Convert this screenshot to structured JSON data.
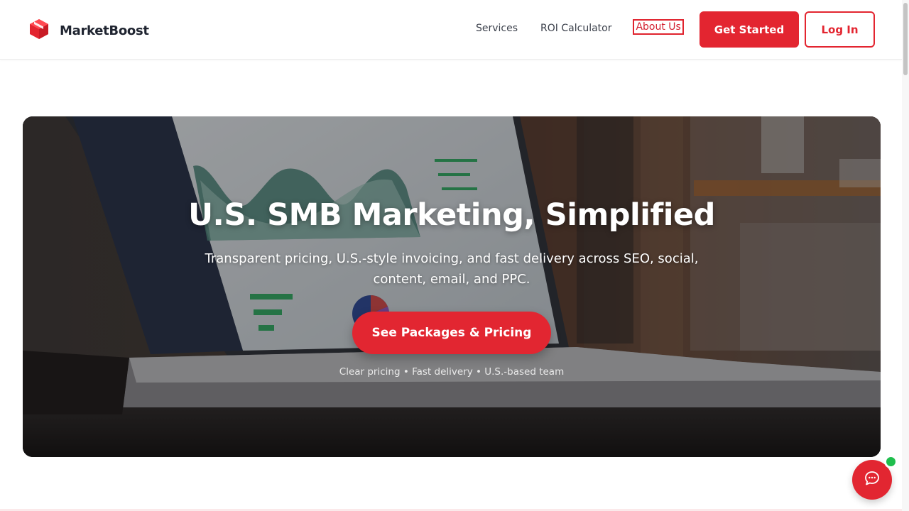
{
  "brand": {
    "name": "MarketBoost",
    "icon": "cube-logo-icon",
    "color": "#e32530"
  },
  "nav": {
    "items": [
      "Services",
      "ROI Calculator",
      "About Us"
    ]
  },
  "header_buttons": {
    "primary": "Get Started",
    "secondary": "Log In"
  },
  "hero": {
    "title": "U.S. SMB Marketing, Simplified",
    "subtitle": "Transparent pricing, U.S.-style invoicing, and fast delivery across SEO, social, content, email, and PPC.",
    "cta": "See Packages & Pricing",
    "tagline": "Clear pricing • Fast delivery • U.S.-based team",
    "background": "laptop showing analytics dashboard on desk"
  },
  "chat": {
    "icon": "chat-bubble-icon",
    "status_color": "#1fbe4d"
  },
  "colors": {
    "accent": "#e32530",
    "text": "#1f2430"
  }
}
